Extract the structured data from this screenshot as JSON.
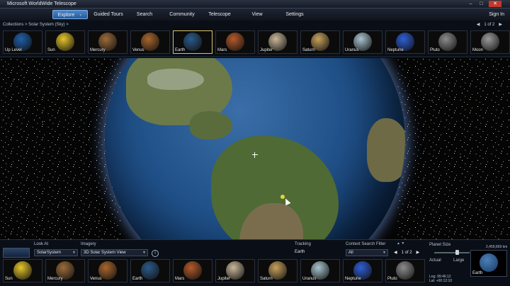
{
  "window": {
    "title": "Microsoft WorldWide Telescope"
  },
  "menu": {
    "items": [
      {
        "label": "Explore",
        "active": true
      },
      {
        "label": "Guided Tours"
      },
      {
        "label": "Search"
      },
      {
        "label": "Community"
      },
      {
        "label": "Telescope"
      },
      {
        "label": "View"
      },
      {
        "label": "Settings"
      }
    ],
    "sign_in": "Sign In"
  },
  "top": {
    "breadcrumb": "Collections  >  Solar System (Sky)  >",
    "page": "1 of 2",
    "thumbs": [
      {
        "label": "Up Level",
        "color": "#1f5fa8"
      },
      {
        "label": "Sun",
        "color": "#e6c52a"
      },
      {
        "label": "Mercury",
        "color": "#9c6b3a"
      },
      {
        "label": "Venus",
        "color": "#a9662d"
      },
      {
        "label": "Earth",
        "color": "#2b5a8a",
        "selected": true
      },
      {
        "label": "Mars",
        "color": "#b35a2a"
      },
      {
        "label": "Jupiter",
        "color": "#c9b79a"
      },
      {
        "label": "Saturn",
        "color": "#c7a15c"
      },
      {
        "label": "Uranus",
        "color": "#a9c4cf"
      },
      {
        "label": "Neptune",
        "color": "#2f5fd6"
      },
      {
        "label": "Pluto",
        "color": "#8c8c8c"
      },
      {
        "label": "Moon",
        "color": "#9a9a9a"
      }
    ]
  },
  "bottom": {
    "look_at_label": "Look At",
    "look_at_value": "SolarSystem",
    "imagery_label": "Imagery",
    "imagery_value": "3D Solar System View",
    "tracking_label": "Tracking",
    "tracking_value": "Earth",
    "context_label": "Context Search Filter",
    "context_value": "All",
    "page": "1 of 2",
    "planet_size_label": "Planet Size",
    "actual_label": "Actual",
    "large_label": "Large",
    "scale_value": "2,459,669 km",
    "earth_label": "Earth",
    "lng": "Lng: 99:46:12",
    "lat": "Lat: +00:12:10",
    "thumbs": [
      {
        "label": "Sun",
        "color": "#e6c52a"
      },
      {
        "label": "Mercury",
        "color": "#9c6b3a"
      },
      {
        "label": "Venus",
        "color": "#a9662d"
      },
      {
        "label": "Earth",
        "color": "#2b5a8a"
      },
      {
        "label": "Mars",
        "color": "#b35a2a"
      },
      {
        "label": "Jupiter",
        "color": "#c9b79a"
      },
      {
        "label": "Saturn",
        "color": "#c7a15c"
      },
      {
        "label": "Uranus",
        "color": "#a9c4cf"
      },
      {
        "label": "Neptune",
        "color": "#2f5fd6"
      },
      {
        "label": "Pluto",
        "color": "#8c8c8c"
      }
    ]
  }
}
